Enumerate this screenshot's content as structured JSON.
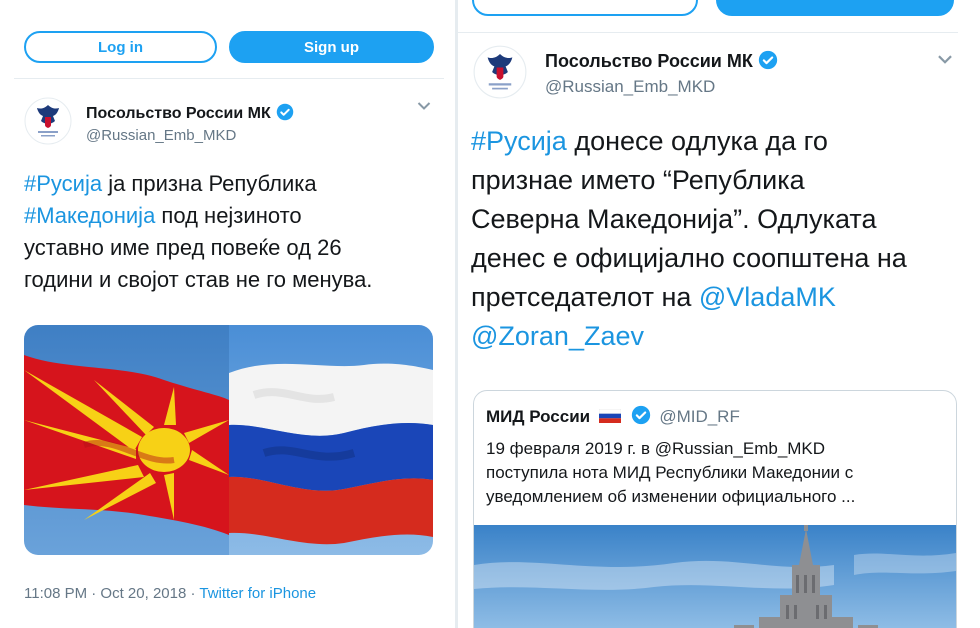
{
  "left": {
    "login_label": "Log in",
    "signup_label": "Sign up",
    "account_name": "Посольство России МК",
    "account_handle": "@Russian_Emb_MKD",
    "tweet_lines": [
      [
        {
          "t": "#Русија",
          "link": true
        },
        {
          "t": " ја призна Република",
          "link": false
        }
      ],
      [
        {
          "t": "#Македонија",
          "link": true
        },
        {
          "t": " под нејзиното",
          "link": false
        }
      ],
      [
        {
          "t": "уставно име пред повеќе од 26",
          "link": false
        }
      ],
      [
        {
          "t": "години и својот став не го менува.",
          "link": false
        }
      ]
    ],
    "timestamp": "11:08 PM · Oct 20, 2018 · ",
    "source": "Twitter for iPhone"
  },
  "right": {
    "account_name": "Посольство России МК",
    "account_handle": "@Russian_Emb_MKD",
    "tweet_lines": [
      [
        {
          "t": "#Русија",
          "link": true
        },
        {
          "t": " донесе одлука да го",
          "link": false
        }
      ],
      [
        {
          "t": "признае името “Република",
          "link": false
        }
      ],
      [
        {
          "t": "Северна Македонија”. Одлуката",
          "link": false
        }
      ],
      [
        {
          "t": "денес е официјално соопштена на",
          "link": false
        }
      ],
      [
        {
          "t": "претседателот на ",
          "link": false
        },
        {
          "t": "@VladaMK",
          "link": true
        }
      ],
      [
        {
          "t": "@Zoran_Zaev",
          "link": true
        }
      ]
    ],
    "quote": {
      "name": "МИД России",
      "handle": "@MID_RF",
      "lines": [
        "19 февраля 2019 г. в @Russian_Emb_MKD",
        "поступила нота МИД Республики Македонии с",
        "уведомлением об изменении официального ..."
      ]
    }
  },
  "colors": {
    "link": "#1b95e0",
    "twitter_blue": "#1da1f2",
    "verified": "#1da1f2",
    "secondary_text": "#657786"
  },
  "icons": [
    "verified-badge-icon",
    "chevron-down-icon",
    "embassy-emblem-icon",
    "russia-flag-emoji-icon"
  ]
}
